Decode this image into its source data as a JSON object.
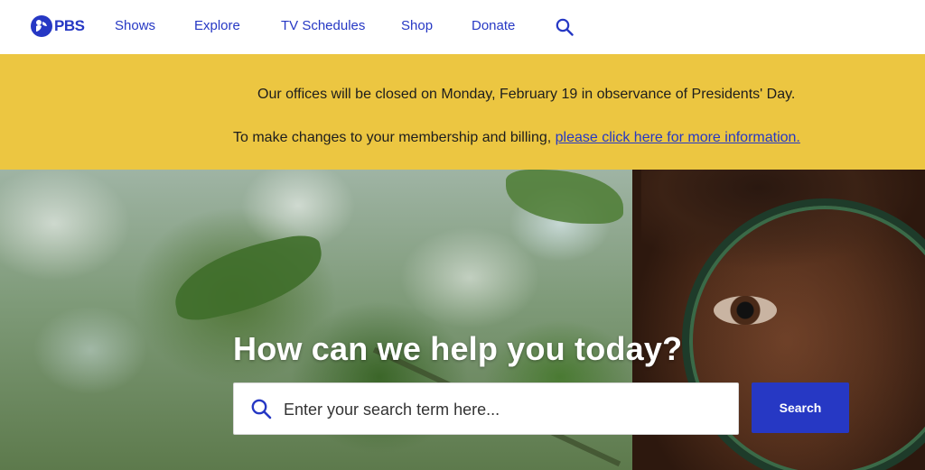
{
  "nav": {
    "logo_text": "PBS",
    "items": [
      {
        "label": "Shows"
      },
      {
        "label": "Explore"
      },
      {
        "label": "TV Schedules"
      },
      {
        "label": "Shop"
      },
      {
        "label": "Donate"
      }
    ],
    "search_icon": "search-icon"
  },
  "banner": {
    "line1": "Our offices will be closed on Monday, February 19 in observance of Presidents' Day.",
    "line2_text": "To make changes to your membership and billing,",
    "line2_link": "please click here for more information."
  },
  "hero": {
    "title": "How can we help you today?",
    "search_placeholder": "Enter your search term here...",
    "search_button": "Search"
  },
  "colors": {
    "brand_blue": "#2638c4",
    "banner_yellow": "#ecc641"
  }
}
